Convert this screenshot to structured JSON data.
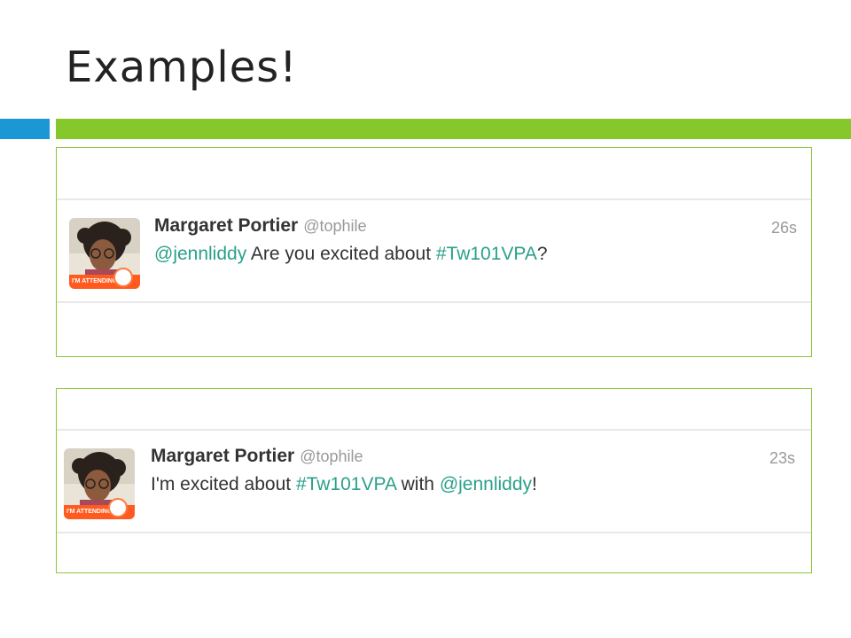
{
  "slide": {
    "title": "Examples!"
  },
  "tweets": [
    {
      "author": "Margaret Portier",
      "handle": "@tophile",
      "time": "26s",
      "badge": "I'M ATTENDING",
      "parts": {
        "mention": "@jennliddy",
        "text_a": " Are you excited about ",
        "hashtag": "#Tw101VPA",
        "text_b": "?"
      }
    },
    {
      "author": "Margaret Portier",
      "handle": "@tophile",
      "time": "23s",
      "badge": "I'M ATTENDING",
      "parts": {
        "text_a": "I'm excited about ",
        "hashtag": "#Tw101VPA",
        "text_b": " with ",
        "mention": "@jennliddy",
        "text_c": "!"
      }
    }
  ],
  "colors": {
    "blue_bar": "#1c97d6",
    "green_bar": "#86c82b",
    "link": "#2aa08a",
    "badge": "#ff5a1f"
  }
}
